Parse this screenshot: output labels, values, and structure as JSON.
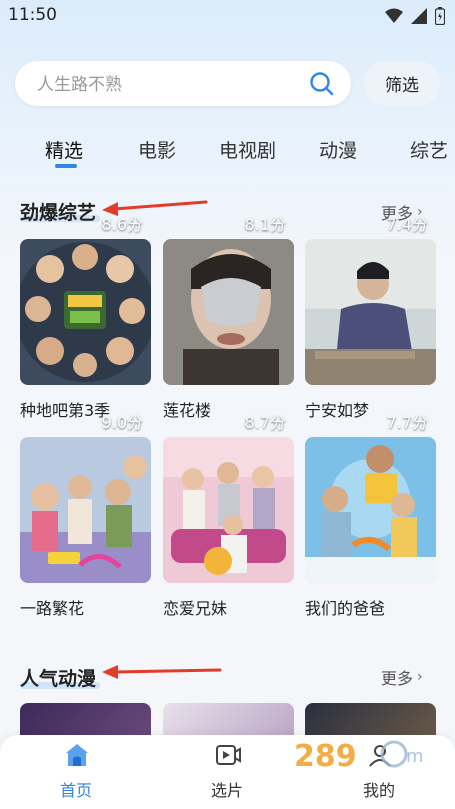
{
  "status_bar": {
    "time": "11:50"
  },
  "search": {
    "placeholder": "人生路不熟"
  },
  "filter_label": "筛选",
  "tabs": [
    {
      "label": "精选"
    },
    {
      "label": "电影"
    },
    {
      "label": "电视剧"
    },
    {
      "label": "动漫"
    },
    {
      "label": "综艺"
    }
  ],
  "sections": [
    {
      "title": "劲爆综艺",
      "more": "更多",
      "items": [
        {
          "title": "种地吧第3季",
          "score": "8.6分"
        },
        {
          "title": "莲花楼",
          "score": "8.1分"
        },
        {
          "title": "宁安如梦",
          "score": "7.4分"
        },
        {
          "title": "一路繁花",
          "score": "9.0分"
        },
        {
          "title": "恋爱兄妹",
          "score": "8.7分"
        },
        {
          "title": "我们的爸爸",
          "score": "7.7分"
        }
      ]
    },
    {
      "title": "人气动漫",
      "more": "更多"
    }
  ],
  "bottom_nav": [
    {
      "label": "首页",
      "icon": "home-icon"
    },
    {
      "label": "选片",
      "icon": "video-icon"
    },
    {
      "label": "我的",
      "icon": "user-icon"
    }
  ],
  "colors": {
    "accent": "#2f86e8",
    "arrow": "#e23b2a"
  }
}
